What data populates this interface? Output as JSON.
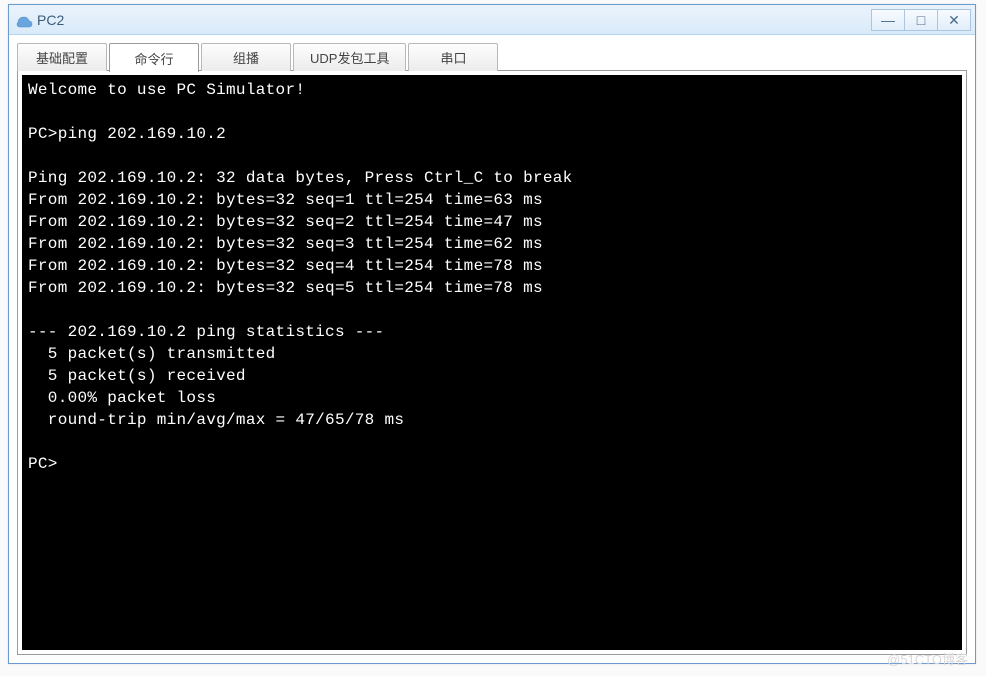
{
  "window": {
    "title": "PC2"
  },
  "tabs": [
    {
      "label": "基础配置",
      "active": false
    },
    {
      "label": "命令行",
      "active": true
    },
    {
      "label": "组播",
      "active": false
    },
    {
      "label": "UDP发包工具",
      "active": false
    },
    {
      "label": "串口",
      "active": false
    }
  ],
  "terminal": {
    "welcome": "Welcome to use PC Simulator!",
    "prompt": "PC>",
    "command": "ping 202.169.10.2",
    "ping_target": "202.169.10.2",
    "ping_header": "Ping 202.169.10.2: 32 data bytes, Press Ctrl_C to break",
    "replies": [
      "From 202.169.10.2: bytes=32 seq=1 ttl=254 time=63 ms",
      "From 202.169.10.2: bytes=32 seq=2 ttl=254 time=47 ms",
      "From 202.169.10.2: bytes=32 seq=3 ttl=254 time=62 ms",
      "From 202.169.10.2: bytes=32 seq=4 ttl=254 time=78 ms",
      "From 202.169.10.2: bytes=32 seq=5 ttl=254 time=78 ms"
    ],
    "stats_header": "--- 202.169.10.2 ping statistics ---",
    "stats": [
      "  5 packet(s) transmitted",
      "  5 packet(s) received",
      "  0.00% packet loss",
      "  round-trip min/avg/max = 47/65/78 ms"
    ]
  },
  "watermark": "@51CTO博客"
}
